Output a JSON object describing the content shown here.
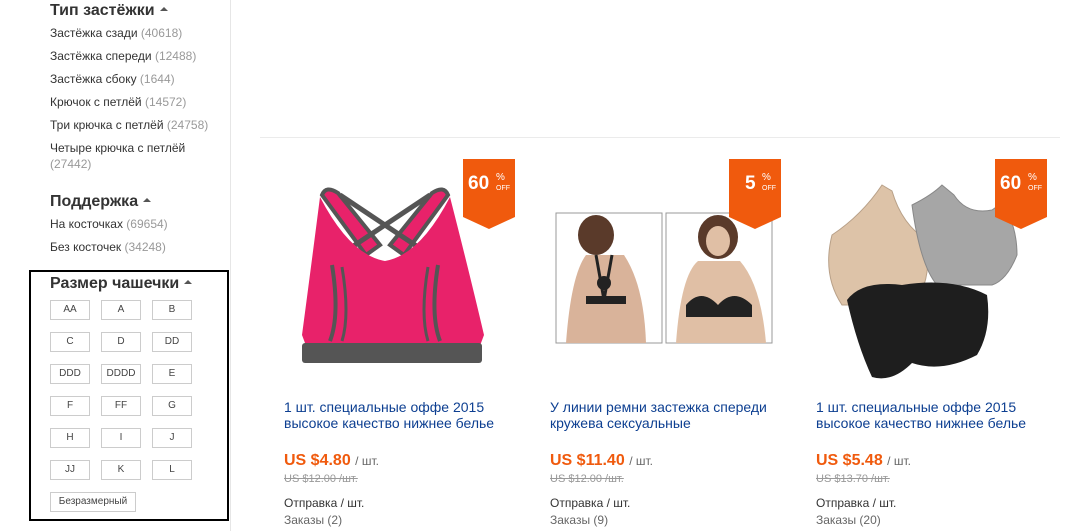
{
  "sidebar": {
    "clasp": {
      "heading": "Тип застёжки",
      "items": [
        {
          "label": "Застёжка сзади",
          "count": "(40618)"
        },
        {
          "label": "Застёжка спереди",
          "count": "(12488)"
        },
        {
          "label": "Застёжка сбоку",
          "count": "(1644)"
        },
        {
          "label": "Крючок с петлёй",
          "count": "(14572)"
        },
        {
          "label": "Три крючка с петлёй",
          "count": "(24758)"
        },
        {
          "label": "Четыре крючка с петлёй",
          "count": "(27442)"
        }
      ]
    },
    "support": {
      "heading": "Поддержка",
      "items": [
        {
          "label": "На косточках",
          "count": "(69654)"
        },
        {
          "label": "Без косточек",
          "count": "(34248)"
        }
      ]
    },
    "cup": {
      "heading": "Размер чашечки",
      "sizes": [
        "AA",
        "A",
        "B",
        "C",
        "D",
        "DD",
        "DDD",
        "DDDD",
        "E",
        "F",
        "FF",
        "G",
        "H",
        "I",
        "J",
        "JJ",
        "K",
        "L"
      ],
      "no_size": "Безразмерный"
    }
  },
  "products": [
    {
      "discount": "60",
      "percent": "%",
      "off": "OFF",
      "title": "1 шт. специальные оффе 2015 высокое качество нижнее белье",
      "price": "US $4.80",
      "unit": "/ шт.",
      "old_price": "US $12.00 /шт.",
      "shipping": "Отправка / шт.",
      "orders": "Заказы (2)",
      "image": "pink-sports-bra"
    },
    {
      "discount": "5",
      "percent": "%",
      "off": "OFF",
      "title": "У линии ремни застежка спереди кружева сексуальные",
      "price": "US $11.40",
      "unit": "/ шт.",
      "old_price": "US $12.00 /шт.",
      "shipping": "Отправка / шт.",
      "orders": "Заказы (9)",
      "image": "black-lace-bra-two-photos"
    },
    {
      "discount": "60",
      "percent": "%",
      "off": "OFF",
      "title": "1 шт. специальные оффе 2015 высокое качество нижнее белье",
      "price": "US $5.48",
      "unit": "/ шт.",
      "old_price": "US $13.70 /шт.",
      "shipping": "Отправка / шт.",
      "orders": "Заказы (20)",
      "image": "three-sports-bras"
    }
  ],
  "colors": {
    "accent": "#f05a0d",
    "link": "#0d3f91",
    "pink": "#e8226a",
    "grey": "#555555"
  }
}
